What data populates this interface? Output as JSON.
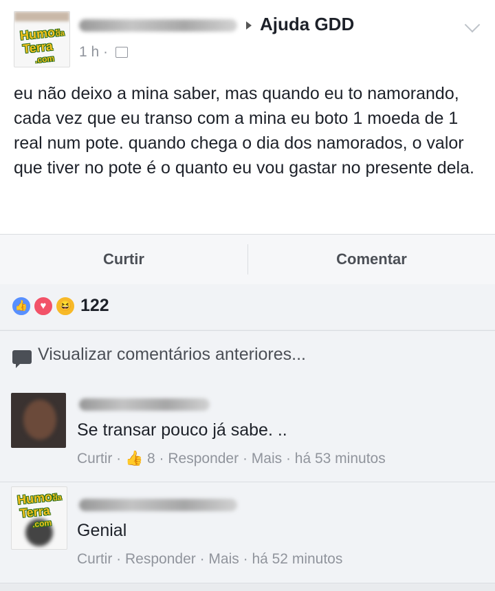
{
  "post": {
    "group_name": "Ajuda GDD",
    "time": "1 h ·",
    "body": "eu não deixo a mina saber, mas quando eu to namorando, cada vez que eu transo com a mina eu boto 1 moeda de 1 real num pote. quando chega o dia dos namorados, o valor que tiver no pote é o quanto eu vou gastar no presente dela.",
    "logo": {
      "line1": "Humor",
      "small": "da",
      "line2": "Terra",
      "line3": ".com"
    }
  },
  "actions": {
    "like": "Curtir",
    "comment": "Comentar"
  },
  "reactions": {
    "count": "122",
    "icons": [
      "like-icon",
      "love-icon",
      "haha-icon"
    ]
  },
  "previous_comments": {
    "label": "Visualizar comentários anteriores..."
  },
  "comments": [
    {
      "text": "Se transar pouco já sabe. ..",
      "like": "Curtir ·",
      "likes": "8",
      "reply": "· Responder ·",
      "more": "Mais ·",
      "time": "há 53 minutos"
    },
    {
      "text": "Genial",
      "like": "Curtir ·",
      "reply": "Responder ·",
      "more": "Mais ·",
      "time": "há 52 minutos"
    }
  ],
  "colors": {
    "meta_gray": "#90949c",
    "bg": "#e9ebee",
    "like_blue": "#5890ff",
    "love_red": "#f25268",
    "haha_yellow": "#f7b928"
  }
}
